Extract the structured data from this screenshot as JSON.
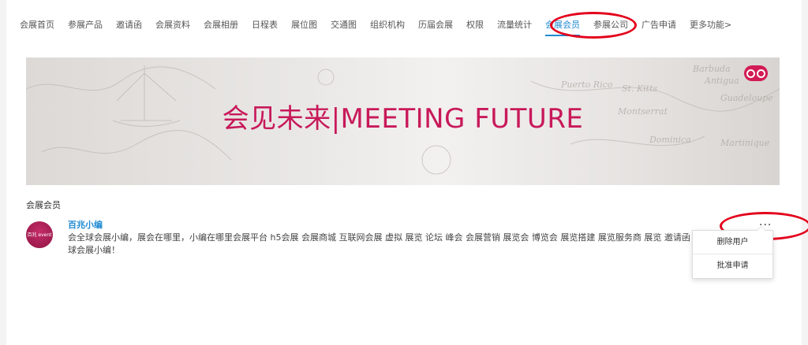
{
  "nav": {
    "items": [
      {
        "label": "会展首页"
      },
      {
        "label": "参展产品"
      },
      {
        "label": "邀请函"
      },
      {
        "label": "会展资料"
      },
      {
        "label": "会展相册"
      },
      {
        "label": "日程表"
      },
      {
        "label": "展位图"
      },
      {
        "label": "交通图"
      },
      {
        "label": "组织机构"
      },
      {
        "label": "历届会展"
      },
      {
        "label": "权限"
      },
      {
        "label": "流量统计"
      },
      {
        "label": "会展会员",
        "active": true
      },
      {
        "label": "参展公司"
      },
      {
        "label": "广告申请"
      },
      {
        "label": "更多功能>"
      }
    ]
  },
  "banner": {
    "text": "会见未来|MEETING FUTURE",
    "map_labels": [
      "Puerto Rico",
      "St. Kitts",
      "Montserrat",
      "Dominica",
      "Antigua",
      "Guadeloupe",
      "Barbuda",
      "Martinique"
    ]
  },
  "section": {
    "title": "会展会员"
  },
  "member": {
    "name": "百兆小编",
    "avatar_text": "百兆 event",
    "description": "会全球会展小编，展会在哪里，小编在哪里会展平台 h5会展 会展商城 互联网会展 虚拟 展览 论坛 峰会 会展营销 展览会 博览会 展览搭建 展览服务商 展览 邀请函 全球会展小编！"
  },
  "more_button": {
    "label": "···"
  },
  "menu": {
    "items": [
      {
        "label": "删除用户"
      },
      {
        "label": "批准申请"
      }
    ]
  },
  "colors": {
    "accent": "#1f8ad2",
    "highlight": "#e3001b",
    "banner_text": "#c8195a"
  }
}
